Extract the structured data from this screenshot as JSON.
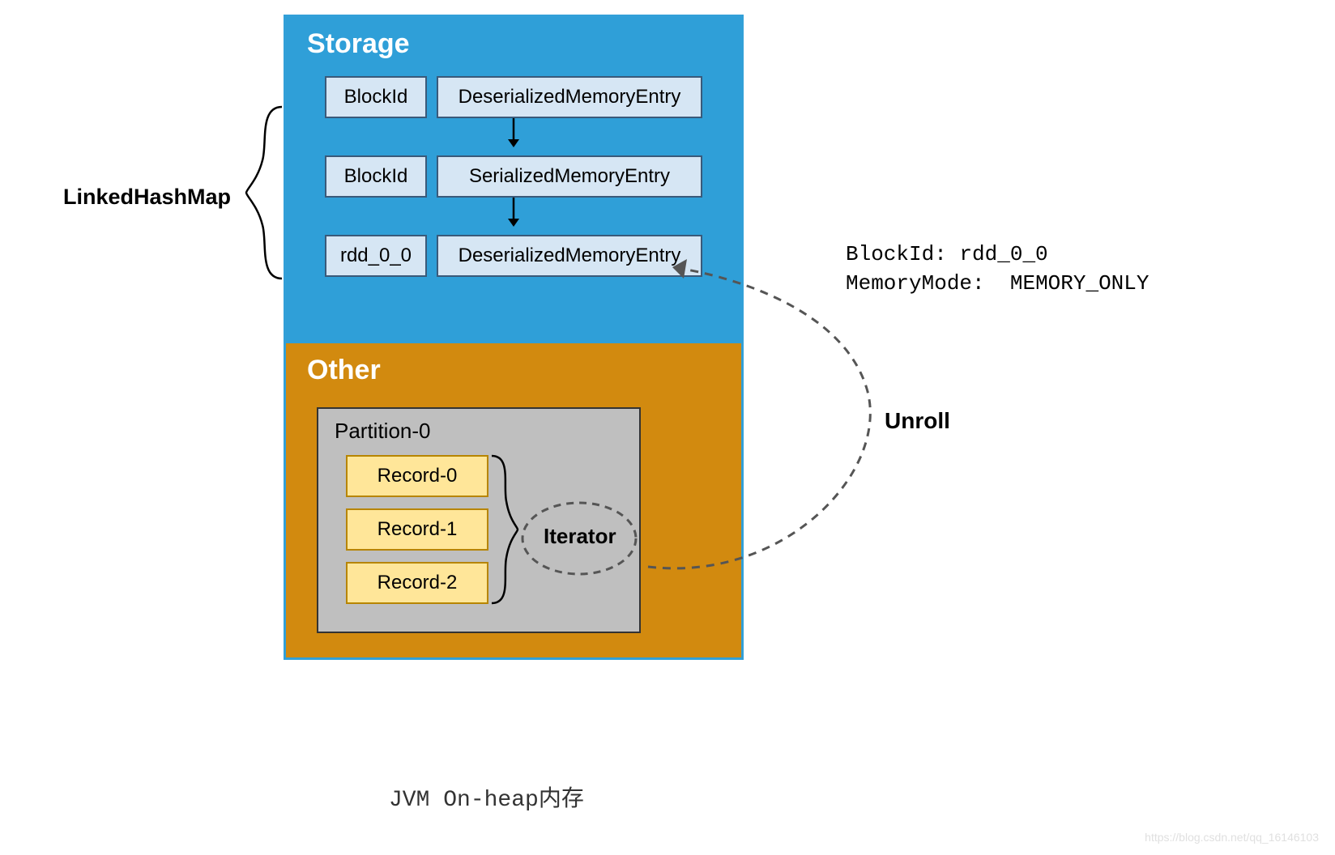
{
  "labels": {
    "linked_hash_map": "LinkedHashMap",
    "unroll": "Unroll",
    "iterator": "Iterator",
    "jvm_caption": "JVM On-heap内存",
    "watermark": "https://blog.csdn.net/qq_16146103"
  },
  "meta": {
    "blockid_label": "BlockId:",
    "blockid_value": "rdd_0_0",
    "memmode_label": "MemoryMode:",
    "memmode_value": "MEMORY_ONLY"
  },
  "storage": {
    "title": "Storage",
    "rows": [
      {
        "key": "BlockId",
        "val": "DeserializedMemoryEntry"
      },
      {
        "key": "BlockId",
        "val": "SerializedMemoryEntry"
      },
      {
        "key": "rdd_0_0",
        "val": "DeserializedMemoryEntry"
      }
    ]
  },
  "other": {
    "title": "Other",
    "partition_title": "Partition-0",
    "records": [
      "Record-0",
      "Record-1",
      "Record-2"
    ]
  }
}
